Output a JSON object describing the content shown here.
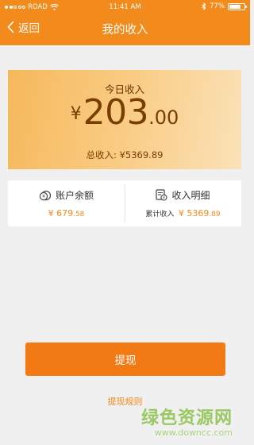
{
  "status_bar": {
    "carrier": "ROAD",
    "time": "11:41 AM",
    "battery": "77%",
    "battery_level": 0.77
  },
  "nav": {
    "back_label": "返回",
    "title": "我的收入"
  },
  "today": {
    "label": "今日收入",
    "currency": "¥",
    "amount_int": "203",
    "amount_dec": ".00",
    "total_label": "总收入:",
    "total_value": "¥5369.89"
  },
  "balance": {
    "label": "账户余额",
    "currency": "¥",
    "value_int": "679",
    "value_dec": ".58"
  },
  "details": {
    "label": "收入明细",
    "cumulative_label": "累计收入",
    "currency": "¥",
    "value_int": "5369",
    "value_dec": ".89"
  },
  "actions": {
    "withdraw_label": "提现",
    "rules_label": "提现规则"
  },
  "watermark": {
    "text_zh": "绿色资源网",
    "text_en": "www.downcc.com"
  },
  "colors": {
    "header": "#f28a1c",
    "accent": "#f27a14",
    "card_gradient_start": "#f6b85b",
    "card_gradient_end": "#fbe2b8",
    "amount_text": "#7a3d00"
  },
  "icons": [
    "signal-dots-icon",
    "wifi-icon",
    "bluetooth-icon",
    "battery-icon",
    "back-chevron-icon",
    "coin-wallet-icon",
    "bill-list-icon"
  ]
}
